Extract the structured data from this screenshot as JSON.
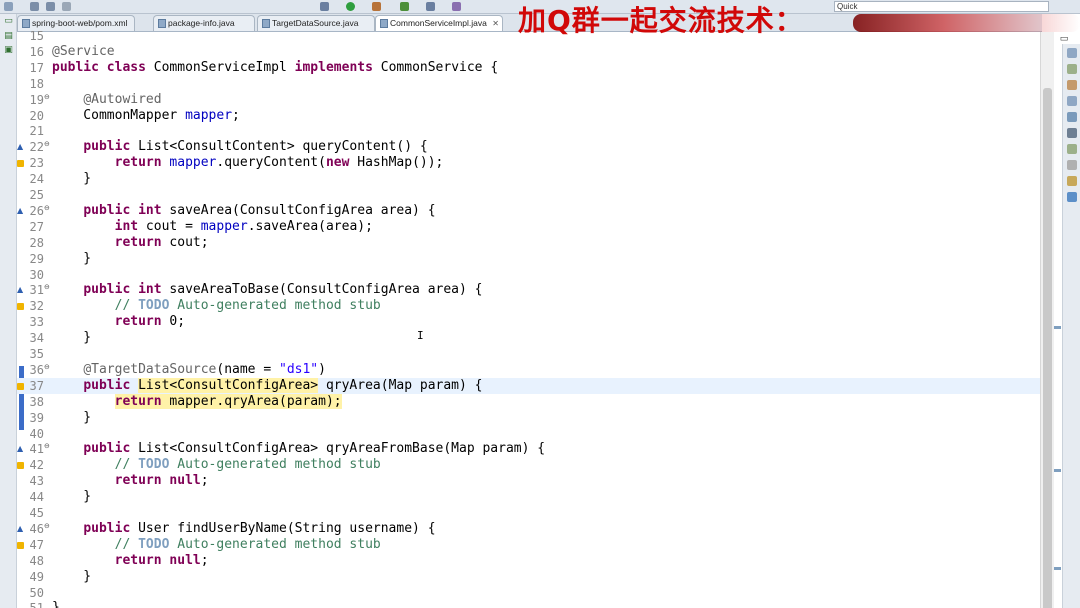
{
  "toolbar": {
    "quick_access": "Quick"
  },
  "tabs": [
    {
      "label": "spring-boot-web/pom.xml",
      "active": false
    },
    {
      "label": "package-info.java",
      "active": false
    },
    {
      "label": "TargetDataSource.java",
      "active": false
    },
    {
      "label": "CommonServiceImpl.java",
      "active": true
    }
  ],
  "overlay": {
    "banner_text": "加Q群一起交流技术："
  },
  "editor": {
    "lines": [
      {
        "n": "15",
        "code": []
      },
      {
        "n": "16",
        "code": [
          [
            "an",
            "@Service"
          ]
        ]
      },
      {
        "n": "17",
        "code": [
          [
            "kw",
            "public"
          ],
          [
            "",
            " "
          ],
          [
            "kw",
            "class"
          ],
          [
            "",
            " CommonServiceImpl "
          ],
          [
            "kw",
            "implements"
          ],
          [
            "",
            " CommonService {"
          ]
        ]
      },
      {
        "n": "18",
        "code": []
      },
      {
        "n": "19",
        "code": [
          [
            "",
            "    "
          ],
          [
            "an",
            "@Autowired"
          ]
        ]
      },
      {
        "n": "20",
        "code": [
          [
            "",
            "    CommonMapper "
          ],
          [
            "fld",
            "mapper"
          ],
          [
            "",
            ";"
          ]
        ]
      },
      {
        "n": "21",
        "code": []
      },
      {
        "n": "22",
        "code": [
          [
            "",
            "    "
          ],
          [
            "kw",
            "public"
          ],
          [
            "",
            " List<ConsultContent> queryContent() {"
          ]
        ]
      },
      {
        "n": "23",
        "code": [
          [
            "",
            "        "
          ],
          [
            "kw",
            "return"
          ],
          [
            "",
            " "
          ],
          [
            "fld",
            "mapper"
          ],
          [
            "",
            ".queryContent("
          ],
          [
            "kw",
            "new"
          ],
          [
            "",
            " HashMap());"
          ]
        ]
      },
      {
        "n": "24",
        "code": [
          [
            "",
            "    }"
          ]
        ]
      },
      {
        "n": "25",
        "code": []
      },
      {
        "n": "26",
        "code": [
          [
            "",
            "    "
          ],
          [
            "kw",
            "public"
          ],
          [
            "",
            " "
          ],
          [
            "kw",
            "int"
          ],
          [
            "",
            " saveArea(ConsultConfigArea area) {"
          ]
        ]
      },
      {
        "n": "27",
        "code": [
          [
            "",
            "        "
          ],
          [
            "kw",
            "int"
          ],
          [
            "",
            " cout = "
          ],
          [
            "fld",
            "mapper"
          ],
          [
            "",
            ".saveArea(area);"
          ]
        ]
      },
      {
        "n": "28",
        "code": [
          [
            "",
            "        "
          ],
          [
            "kw",
            "return"
          ],
          [
            "",
            " cout;"
          ]
        ]
      },
      {
        "n": "29",
        "code": [
          [
            "",
            "    }"
          ]
        ]
      },
      {
        "n": "30",
        "code": []
      },
      {
        "n": "31",
        "code": [
          [
            "",
            "    "
          ],
          [
            "kw",
            "public"
          ],
          [
            "",
            " "
          ],
          [
            "kw",
            "int"
          ],
          [
            "",
            " saveAreaToBase(ConsultConfigArea area) {"
          ]
        ]
      },
      {
        "n": "32",
        "code": [
          [
            "",
            "        "
          ],
          [
            "cm",
            "// "
          ],
          [
            "todo",
            "TODO"
          ],
          [
            "cm",
            " Auto-generated method stub"
          ]
        ]
      },
      {
        "n": "33",
        "code": [
          [
            "",
            "        "
          ],
          [
            "kw",
            "return"
          ],
          [
            "",
            " 0;"
          ]
        ]
      },
      {
        "n": "34",
        "code": [
          [
            "",
            "    }"
          ]
        ]
      },
      {
        "n": "35",
        "code": []
      },
      {
        "n": "36",
        "code": [
          [
            "",
            "    "
          ],
          [
            "an",
            "@TargetDataSource"
          ],
          [
            "",
            "(name = "
          ],
          [
            "str",
            "\"ds1\""
          ],
          [
            "",
            ")"
          ]
        ]
      },
      {
        "n": "37",
        "code": [
          [
            "",
            "    "
          ],
          [
            "kw",
            "public"
          ],
          [
            "",
            " "
          ],
          [
            "hl",
            "List<ConsultConfigArea>"
          ],
          [
            "",
            " qryArea(Map param) {"
          ]
        ]
      },
      {
        "n": "38",
        "code": [
          [
            "",
            "        "
          ],
          [
            "kwhl",
            "return"
          ],
          [
            "hl",
            " mapper.qryArea(param);"
          ]
        ]
      },
      {
        "n": "39",
        "code": [
          [
            "",
            "    }"
          ]
        ]
      },
      {
        "n": "40",
        "code": []
      },
      {
        "n": "41",
        "code": [
          [
            "",
            "    "
          ],
          [
            "kw",
            "public"
          ],
          [
            "",
            " List<ConsultConfigArea> qryAreaFromBase(Map param) {"
          ]
        ]
      },
      {
        "n": "42",
        "code": [
          [
            "",
            "        "
          ],
          [
            "cm",
            "// "
          ],
          [
            "todo",
            "TODO"
          ],
          [
            "cm",
            " Auto-generated method stub"
          ]
        ]
      },
      {
        "n": "43",
        "code": [
          [
            "",
            "        "
          ],
          [
            "kw",
            "return"
          ],
          [
            "",
            " "
          ],
          [
            "kw",
            "null"
          ],
          [
            "",
            ";"
          ]
        ]
      },
      {
        "n": "44",
        "code": [
          [
            "",
            "    }"
          ]
        ]
      },
      {
        "n": "45",
        "code": []
      },
      {
        "n": "46",
        "code": [
          [
            "",
            "    "
          ],
          [
            "kw",
            "public"
          ],
          [
            "",
            " User findUserByName(String username) {"
          ]
        ]
      },
      {
        "n": "47",
        "code": [
          [
            "",
            "        "
          ],
          [
            "cm",
            "// "
          ],
          [
            "todo",
            "TODO"
          ],
          [
            "cm",
            " Auto-generated method stub"
          ]
        ]
      },
      {
        "n": "48",
        "code": [
          [
            "",
            "        "
          ],
          [
            "kw",
            "return"
          ],
          [
            "",
            " "
          ],
          [
            "kw",
            "null"
          ],
          [
            "",
            ";"
          ]
        ]
      },
      {
        "n": "49",
        "code": [
          [
            "",
            "    }"
          ]
        ]
      },
      {
        "n": "50",
        "code": []
      },
      {
        "n": "51",
        "code": [
          [
            "",
            "}"
          ]
        ]
      }
    ]
  },
  "cursor_glyph": "I"
}
